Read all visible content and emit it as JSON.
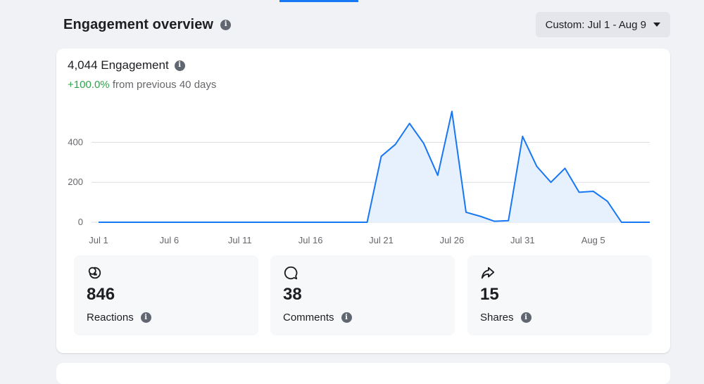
{
  "header": {
    "title": "Engagement overview",
    "date_range_label": "Custom: Jul 1 - Aug 9"
  },
  "metric": {
    "value_label": "4,044 Engagement",
    "change_pct": "+100.0%",
    "change_suffix": "from previous 40 days"
  },
  "colors": {
    "line": "#1877f2",
    "area": "#e7f0fd",
    "positive": "#31a24c"
  },
  "chart_data": {
    "type": "area",
    "xlabel": "",
    "ylabel": "",
    "ylim": [
      0,
      560
    ],
    "yticks": [
      0,
      200,
      400
    ],
    "xtick_labels": [
      "Jul 1",
      "Jul 6",
      "Jul 11",
      "Jul 16",
      "Jul 21",
      "Jul 26",
      "Jul 31",
      "Aug 5"
    ],
    "grid": true,
    "x": [
      "Jul 1",
      "Jul 2",
      "Jul 3",
      "Jul 4",
      "Jul 5",
      "Jul 6",
      "Jul 7",
      "Jul 8",
      "Jul 9",
      "Jul 10",
      "Jul 11",
      "Jul 12",
      "Jul 13",
      "Jul 14",
      "Jul 15",
      "Jul 16",
      "Jul 17",
      "Jul 18",
      "Jul 19",
      "Jul 20",
      "Jul 21",
      "Jul 22",
      "Jul 23",
      "Jul 24",
      "Jul 25",
      "Jul 26",
      "Jul 27",
      "Jul 28",
      "Jul 29",
      "Jul 30",
      "Jul 31",
      "Aug 1",
      "Aug 2",
      "Aug 3",
      "Aug 4",
      "Aug 5",
      "Aug 6",
      "Aug 7",
      "Aug 8",
      "Aug 9"
    ],
    "values": [
      0,
      0,
      0,
      0,
      0,
      0,
      0,
      0,
      0,
      0,
      0,
      0,
      0,
      0,
      0,
      0,
      0,
      0,
      0,
      0,
      330,
      390,
      495,
      395,
      235,
      555,
      50,
      30,
      5,
      8,
      430,
      280,
      200,
      270,
      150,
      155,
      105,
      0,
      0,
      0
    ]
  },
  "stats": [
    {
      "icon": "reactions-icon",
      "value": "846",
      "label": "Reactions"
    },
    {
      "icon": "comments-icon",
      "value": "38",
      "label": "Comments"
    },
    {
      "icon": "shares-icon",
      "value": "15",
      "label": "Shares"
    }
  ]
}
